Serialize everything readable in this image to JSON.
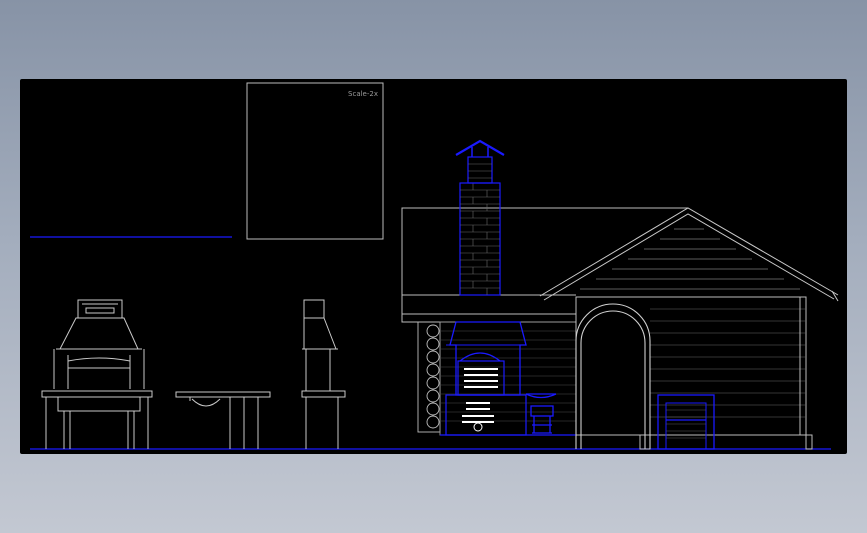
{
  "viewport": {
    "scale_label": "Scale-2x",
    "colors": {
      "background": "#000000",
      "line_white": "#cfcfcf",
      "line_blue": "#1a1aff",
      "line_darkblue": "#0000c8"
    }
  },
  "drawing": {
    "objects": [
      "ground-line",
      "reference-line",
      "detail-frame",
      "bbq-grill-front-elevation",
      "bench-table-elevation",
      "bbq-grill-side-elevation",
      "pavilion-elevation",
      "chimney",
      "stove-oven",
      "brazier-stand",
      "log-wall",
      "gable-roof",
      "arched-doorway",
      "wood-crate"
    ]
  }
}
